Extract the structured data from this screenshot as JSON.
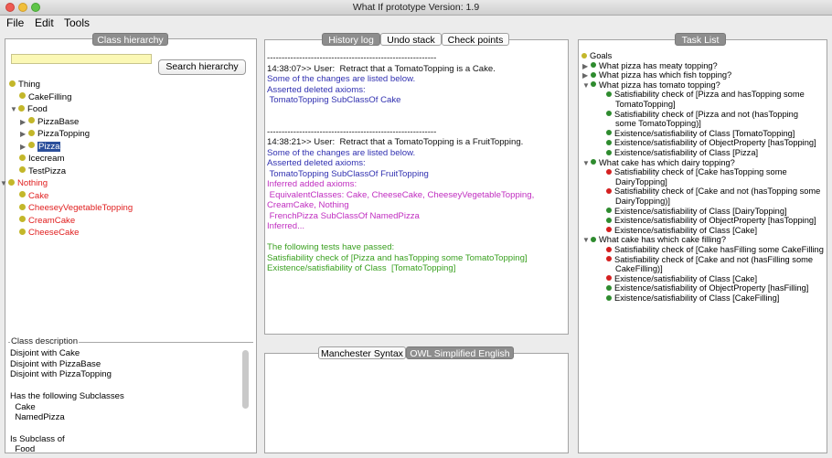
{
  "window": {
    "title": "What If prototype Version: 1.9"
  },
  "menu": [
    "File",
    "Edit",
    "Tools"
  ],
  "hierarchy": {
    "title": "Class hierarchy",
    "search_button": "Search hierarchy",
    "search_value": "",
    "items": [
      {
        "label": "Thing",
        "color": "black",
        "expand": ""
      },
      {
        "label": "CakeFilling",
        "color": "black",
        "expand": ""
      },
      {
        "label": "Food",
        "color": "black",
        "expand": "▼"
      },
      {
        "label": "PizzaBase",
        "color": "black",
        "expand": "▶"
      },
      {
        "label": "PizzaTopping",
        "color": "black",
        "expand": "▶"
      },
      {
        "label": "Pizza",
        "color": "black",
        "expand": "▶",
        "selected": true
      },
      {
        "label": "Icecream",
        "color": "black",
        "expand": ""
      },
      {
        "label": "TestPizza",
        "color": "black",
        "expand": ""
      },
      {
        "label": "Nothing",
        "color": "red",
        "expand": "▼"
      },
      {
        "label": "Cake",
        "color": "red",
        "expand": ""
      },
      {
        "label": "CheeseyVegetableTopping",
        "color": "red",
        "expand": ""
      },
      {
        "label": "CreamCake",
        "color": "red",
        "expand": ""
      },
      {
        "label": "CheeseCake",
        "color": "red",
        "expand": ""
      }
    ]
  },
  "description": {
    "legend": "Class description",
    "lines": [
      "Disjoint with Cake",
      "Disjoint with PizzaBase",
      "Disjoint with PizzaTopping",
      "",
      "Has the following Subclasses",
      "  Cake",
      "  NamedPizza",
      "",
      "Is Subclass of",
      "  Food"
    ]
  },
  "center": {
    "tabs": [
      "History log",
      "Undo stack",
      "Check points"
    ],
    "log": [
      {
        "text": "----------------------------------------------------------",
        "color": "black"
      },
      {
        "text": "14:38:07>> User:  Retract that a TomatoTopping is a Cake.",
        "color": "black"
      },
      {
        "text": "Some of the changes are listed below.",
        "color": "blue"
      },
      {
        "text": "Asserted deleted axioms:",
        "color": "blue"
      },
      {
        "text": " TomatoTopping SubClassOf Cake",
        "color": "blue"
      },
      {
        "text": "",
        "color": "black"
      },
      {
        "text": "",
        "color": "black"
      },
      {
        "text": "----------------------------------------------------------",
        "color": "black"
      },
      {
        "text": "14:38:21>> User:  Retract that a TomatoTopping is a FruitTopping.",
        "color": "black"
      },
      {
        "text": "Some of the changes are listed below.",
        "color": "blue"
      },
      {
        "text": "Asserted deleted axioms:",
        "color": "blue"
      },
      {
        "text": " TomatoTopping SubClassOf FruitTopping",
        "color": "blue"
      },
      {
        "text": "Inferred added axioms:",
        "color": "magenta"
      },
      {
        "text": " EquivalentClasses: Cake, CheeseCake, CheeseyVegetableTopping,",
        "color": "magenta"
      },
      {
        "text": "CreamCake, Nothing",
        "color": "magenta"
      },
      {
        "text": " FrenchPizza SubClassOf NamedPizza",
        "color": "magenta"
      },
      {
        "text": "Inferred...",
        "color": "magenta"
      },
      {
        "text": "",
        "color": "black"
      },
      {
        "text": "The following tests have passed:",
        "color": "green"
      },
      {
        "text": "Satisfiability check of [Pizza and hasTopping some TomatoTopping]",
        "color": "green"
      },
      {
        "text": "Existence/satisfiability of Class  [TomatoTopping]",
        "color": "green"
      }
    ],
    "bottom_tabs": [
      "Manchester Syntax",
      "OWL Simplified English"
    ]
  },
  "tasks": {
    "title": "Task List",
    "items": [
      {
        "label": "Goals",
        "dot": "yellow",
        "level": 0,
        "expand": ""
      },
      {
        "label": "What pizza has meaty topping?",
        "dot": "green",
        "level": 1,
        "expand": "▶"
      },
      {
        "label": "What pizza has which fish topping?",
        "dot": "green",
        "level": 1,
        "expand": "▶"
      },
      {
        "label": "What pizza has tomato topping?",
        "dot": "green",
        "level": 1,
        "expand": "▼"
      },
      {
        "label": "Satisfiability check of [Pizza and hasTopping some",
        "dot": "green",
        "level": 2,
        "expand": ""
      },
      {
        "label": "TomatoTopping]",
        "dot": "",
        "level": 3,
        "expand": ""
      },
      {
        "label": "Satisfiability check of [Pizza and not (hasTopping",
        "dot": "green",
        "level": 2,
        "expand": ""
      },
      {
        "label": "some TomatoTopping)]",
        "dot": "",
        "level": 3,
        "expand": ""
      },
      {
        "label": "Existence/satisfiability of Class [TomatoTopping]",
        "dot": "green",
        "level": 2,
        "expand": ""
      },
      {
        "label": "Existence/satisfiability of ObjectProperty [hasTopping]",
        "dot": "green",
        "level": 2,
        "expand": ""
      },
      {
        "label": "Existence/satisfiability of Class [Pizza]",
        "dot": "green",
        "level": 2,
        "expand": ""
      },
      {
        "label": "What cake has which dairy topping?",
        "dot": "green",
        "level": 1,
        "expand": "▼"
      },
      {
        "label": "Satisfiability check of [Cake hasTopping some",
        "dot": "red",
        "level": 2,
        "expand": ""
      },
      {
        "label": "DairyTopping]",
        "dot": "",
        "level": 3,
        "expand": ""
      },
      {
        "label": "Satisfiability check of [Cake and not (hasTopping some",
        "dot": "red",
        "level": 2,
        "expand": ""
      },
      {
        "label": "DairyTopping)]",
        "dot": "",
        "level": 3,
        "expand": ""
      },
      {
        "label": "Existence/satisfiability of Class [DairyTopping]",
        "dot": "green",
        "level": 2,
        "expand": ""
      },
      {
        "label": "Existence/satisfiability of ObjectProperty [hasTopping]",
        "dot": "green",
        "level": 2,
        "expand": ""
      },
      {
        "label": "Existence/satisfiability of Class [Cake]",
        "dot": "red",
        "level": 2,
        "expand": ""
      },
      {
        "label": "What cake has which cake filling?",
        "dot": "green",
        "level": 1,
        "expand": "▼"
      },
      {
        "label": "Satisfiability check of [Cake hasFilling some CakeFilling",
        "dot": "red",
        "level": 2,
        "expand": ""
      },
      {
        "label": "Satisfiability check of [Cake and not (hasFilling some",
        "dot": "red",
        "level": 2,
        "expand": ""
      },
      {
        "label": "CakeFilling)]",
        "dot": "",
        "level": 3,
        "expand": ""
      },
      {
        "label": "Existence/satisfiability of Class [Cake]",
        "dot": "red",
        "level": 2,
        "expand": ""
      },
      {
        "label": "Existence/satisfiability of ObjectProperty [hasFilling]",
        "dot": "green",
        "level": 2,
        "expand": ""
      },
      {
        "label": "Existence/satisfiability of Class [CakeFilling]",
        "dot": "green",
        "level": 2,
        "expand": ""
      }
    ]
  }
}
